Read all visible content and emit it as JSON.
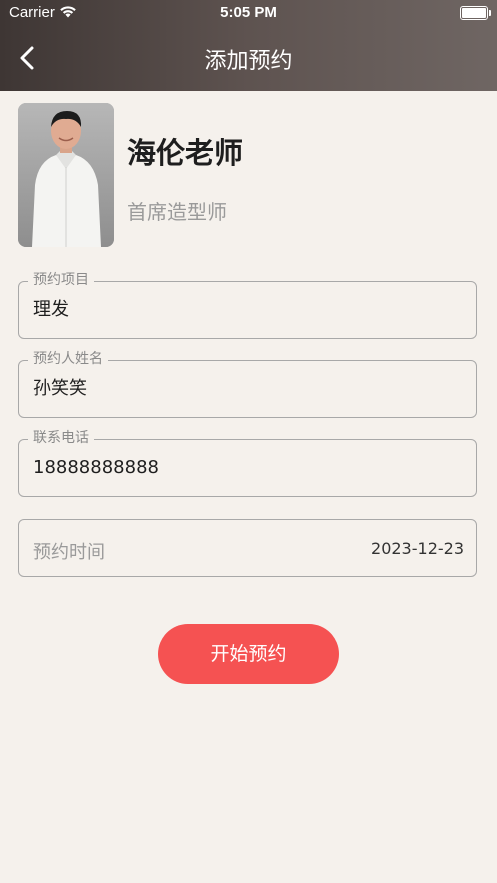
{
  "status_bar": {
    "carrier": "Carrier",
    "time": "5:05 PM"
  },
  "nav": {
    "title": "添加预约",
    "back_icon": "chevron-left-icon"
  },
  "stylist": {
    "name": "海伦老师",
    "role": "首席造型师"
  },
  "form": {
    "service": {
      "label": "预约项目",
      "value": "理发"
    },
    "customer_name": {
      "label": "预约人姓名",
      "value": "孙笑笑"
    },
    "phone": {
      "label": "联系电话",
      "value": "18888888888"
    },
    "time": {
      "label": "预约时间",
      "value": "2023-12-23"
    }
  },
  "submit_label": "开始预约",
  "colors": {
    "accent": "#f55252",
    "background": "#f5f1ec",
    "header": "#5e5350"
  }
}
